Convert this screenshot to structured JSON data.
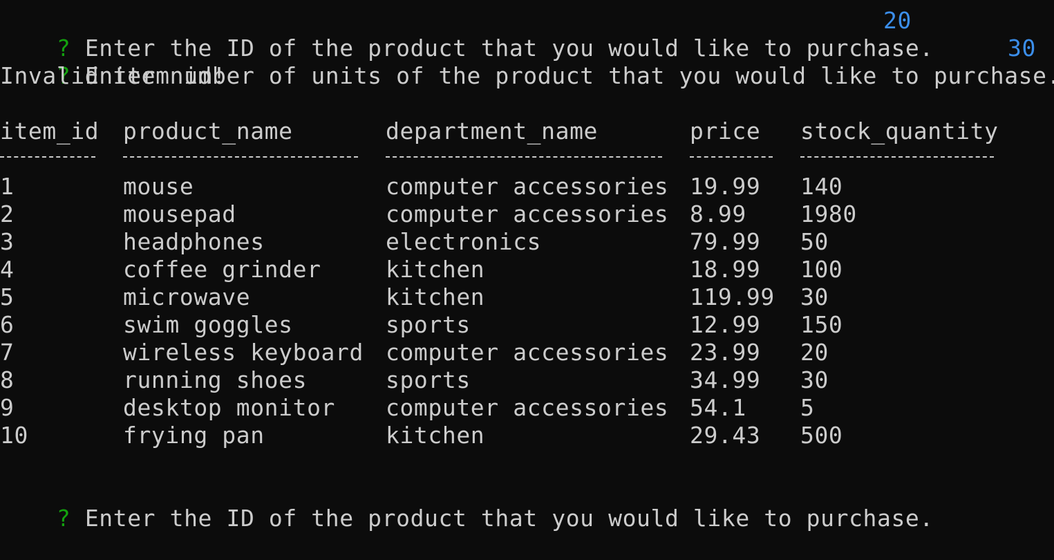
{
  "prompt_mark": "?",
  "prompt_id": "Enter the ID of the product that you would like to purchase.",
  "answer_id": "20",
  "prompt_units": "Enter number of units of the product that you would like to purchase.",
  "answer_units": "30",
  "error_message": "Invalid item id!",
  "table": {
    "headers": [
      "item_id",
      "product_name",
      "department_name",
      "price",
      "stock_quantity"
    ],
    "rows": [
      [
        "1",
        "mouse",
        "computer accessories",
        "19.99",
        "140"
      ],
      [
        "2",
        "mousepad",
        "computer accessories",
        "8.99",
        "1980"
      ],
      [
        "3",
        "headphones",
        "electronics",
        "79.99",
        "50"
      ],
      [
        "4",
        "coffee grinder",
        "kitchen",
        "18.99",
        "100"
      ],
      [
        "5",
        "microwave",
        "kitchen",
        "119.99",
        "30"
      ],
      [
        "6",
        "swim goggles",
        "sports",
        "12.99",
        "150"
      ],
      [
        "7",
        "wireless keyboard",
        "computer accessories",
        "23.99",
        "20"
      ],
      [
        "8",
        "running shoes",
        "sports",
        "34.99",
        "30"
      ],
      [
        "9",
        "desktop monitor",
        "computer accessories",
        "54.1",
        "5"
      ],
      [
        "10",
        "frying pan",
        "kitchen",
        "29.43",
        "500"
      ]
    ]
  },
  "colors": {
    "background": "#0c0c0c",
    "text": "#cccccc",
    "prompt_mark": "#13a10e",
    "answer": "#3b8eea"
  }
}
